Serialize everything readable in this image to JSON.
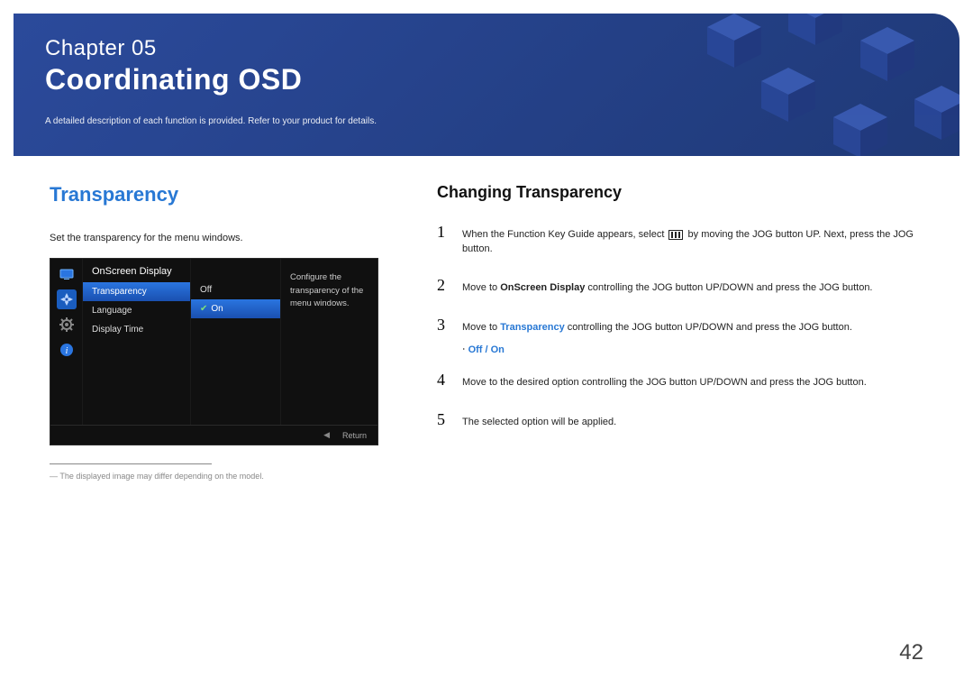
{
  "chapter": {
    "label": "Chapter  05",
    "title": "Coordinating OSD",
    "description": "A detailed description of each function is provided. Refer to your product for details."
  },
  "left": {
    "heading": "Transparency",
    "intro": "Set the transparency for the menu windows.",
    "osd": {
      "header": "OnScreen Display",
      "items": [
        "Transparency",
        "Language",
        "Display Time"
      ],
      "values": [
        "Off",
        "On"
      ],
      "desc": "Configure the transparency of the menu windows.",
      "footer_return": "Return"
    },
    "footnote": "―  The displayed image may differ depending on the model."
  },
  "right": {
    "heading": "Changing Transparency",
    "steps": {
      "s1_a": "When the Function Key Guide appears, select ",
      "s1_b": " by moving the JOG button UP. Next, press the JOG button.",
      "s2_a": "Move to ",
      "s2_bold": "OnScreen Display",
      "s2_b": " controlling the JOG button UP/DOWN and press the JOG button.",
      "s3_a": "Move to ",
      "s3_bold": "Transparency",
      "s3_b": " controlling the JOG button UP/DOWN and press the JOG button.",
      "bullet_off": "Off",
      "bullet_sep": " / ",
      "bullet_on": "On",
      "s4": "Move to the desired option controlling the JOG button UP/DOWN and press the JOG button.",
      "s5": "The selected option will be applied."
    },
    "nums": [
      "1",
      "2",
      "3",
      "4",
      "5"
    ]
  },
  "page_number": "42"
}
